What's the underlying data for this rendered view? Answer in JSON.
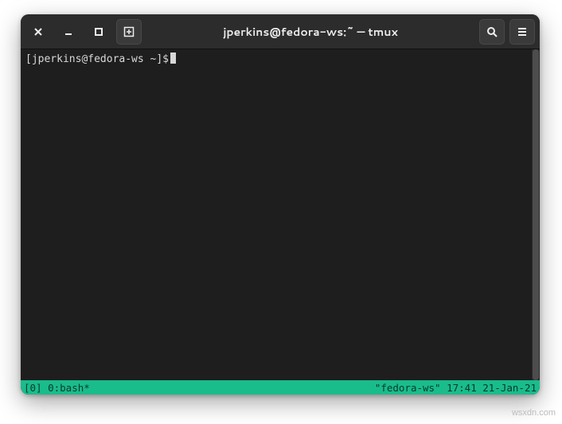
{
  "titlebar": {
    "title": "jperkins@fedora-ws:~ — tmux",
    "icons": {
      "close": "close-icon",
      "minimize": "minimize-icon",
      "maximize": "maximize-icon",
      "new_tab": "new-tab-icon",
      "search": "search-icon",
      "menu": "hamburger-icon"
    }
  },
  "terminal": {
    "prompt": "[jperkins@fedora-ws ~]$"
  },
  "statusbar": {
    "left": "[0] 0:bash*",
    "right": "\"fedora-ws\" 17:41 21-Jan-21"
  },
  "watermark": "wsxdn.com"
}
